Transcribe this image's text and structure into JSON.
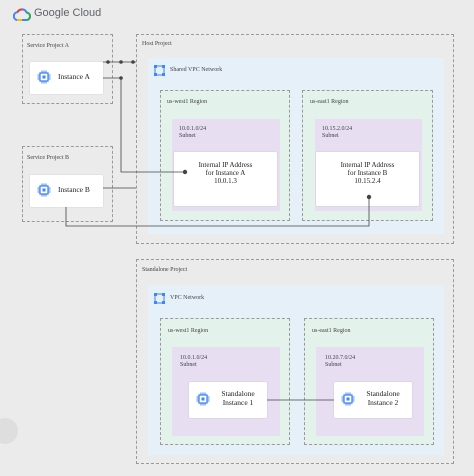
{
  "header": {
    "logo_text": "Google Cloud",
    "logo_icon": "google-cloud-logo-icon"
  },
  "service_project_a": {
    "label": "Service Project A",
    "instance_label": "Instance A"
  },
  "service_project_b": {
    "label": "Service Project B",
    "instance_label": "Instance B"
  },
  "host_project": {
    "label": "Host Project",
    "vpc_label": "Shared VPC Network",
    "west_region": {
      "label": "us-west1 Region",
      "subnet_cidr": "10.0.1.0/24",
      "subnet_label": "Subnet",
      "card_line1": "Internal IP Address",
      "card_line2": "for Instance A",
      "card_ip": "10.0.1.3"
    },
    "east_region": {
      "label": "us-east1 Region",
      "subnet_cidr": "10.15.2.0/24",
      "subnet_label": "Subnet",
      "card_line1": "Internal IP Address",
      "card_line2": "for Instance B",
      "card_ip": "10.15.2.4"
    }
  },
  "standalone_project": {
    "label": "Standalone Project",
    "vpc_label": "VPC Network",
    "west_region": {
      "label": "us-west1 Region",
      "subnet_cidr": "10.0.1.0/24",
      "subnet_label": "Subnet",
      "instance_line1": "Standalone",
      "instance_line2": "Instance 1"
    },
    "east_region": {
      "label": "us-east1 Region",
      "subnet_cidr": "10.20.7.0/24",
      "subnet_label": "Subnet",
      "instance_line1": "Standalone",
      "instance_line2": "Instance 2"
    }
  },
  "colors": {
    "background": "#ebebeb",
    "vpc_fill": "#e5f0f8",
    "region_fill": "#e4f2ec",
    "subnet_fill": "#e7def2",
    "chip_blue": "#4285f4"
  }
}
